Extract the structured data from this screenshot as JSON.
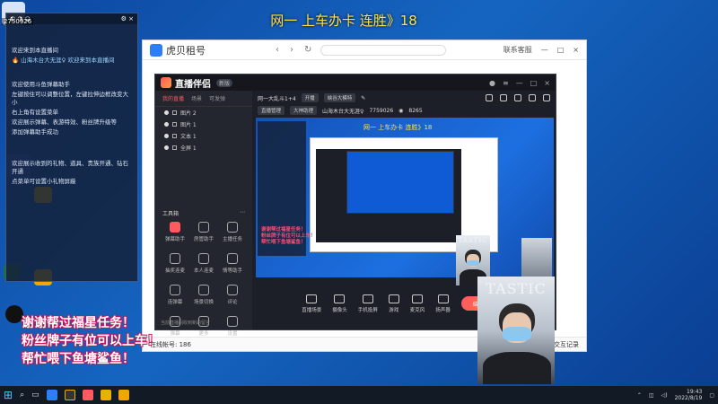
{
  "stream_title": "网一 上车办卡 连胜》18",
  "room_number": "2750926",
  "chat": {
    "messages": [
      "欢迎来到本直播间",
      "🔥 山海木台大无涯♀ 欢迎来到本直播间",
      "",
      "欢迎使用斗鱼弹幕助手",
      "左键按住可以调整位置，左键拉伸边框改变大小",
      "右上角有设置菜单",
      "欢迎展示弹幕、表游特效、粉丝牌升级等",
      "添加弹幕助手成功",
      "",
      "欢迎展示收到的礼物、道具、贵族开通、钻石开通",
      "点菜单可设置小礼物屏蔽"
    ]
  },
  "big_lines": [
    "谢谢帮过福星任务！",
    "粉丝牌子有位可以上车！",
    "帮忙喂下鱼塘鲨鱼！"
  ],
  "outer_window": {
    "app_name": "虎贝租号",
    "right_label": "联系客服",
    "footer_left": "在线帐号: 186",
    "footer_right": "交互记录"
  },
  "app": {
    "name": "直播伴侣",
    "version": "新版",
    "tabs": [
      "我的直播",
      "场景",
      "可发弹"
    ],
    "layers": [
      "图片 2",
      "图片 1",
      "文本 1",
      "全屏 1"
    ],
    "tools_title": "工具箱",
    "tools": [
      "弹幕助手",
      "房管助手",
      "主播任务",
      "抽奖连麦",
      "本人连麦",
      "情等助手",
      "连弹幕",
      "场景切换",
      "评论",
      "弹幕",
      "更多",
      "设置"
    ],
    "left_footer": "当前直播间收到新的留言",
    "room_name": "网一大乱斗1+4",
    "pill1": "开播",
    "pill2": "峡谷大模特",
    "tag1": "直播管理",
    "tag2": "大神助理",
    "anchor_name": "山海木台大无涯♀",
    "anchor_id": "7759026",
    "heat": "8265",
    "preview_title": "网一 上车办卡 连胜》18",
    "preview_red": [
      "谢谢帮过福星任务！",
      "粉丝牌子有位可以上车！",
      "帮忙喂下鱼塘鲨鱼！"
    ],
    "controls": [
      "直播场景",
      "摄像头",
      "手机投屏",
      "游戏",
      "麦克风",
      "扬声器"
    ],
    "live_button": "结束直播"
  },
  "cam_big_word": "TASTIC",
  "cam_small_word": "TASTIC",
  "taskbar": {
    "time": "19:43",
    "date": "2022/8/19"
  },
  "colors": {
    "stream_title": "#ffe14d",
    "accent": "#ff5a5f",
    "big_text_outline": "#c2185b"
  }
}
